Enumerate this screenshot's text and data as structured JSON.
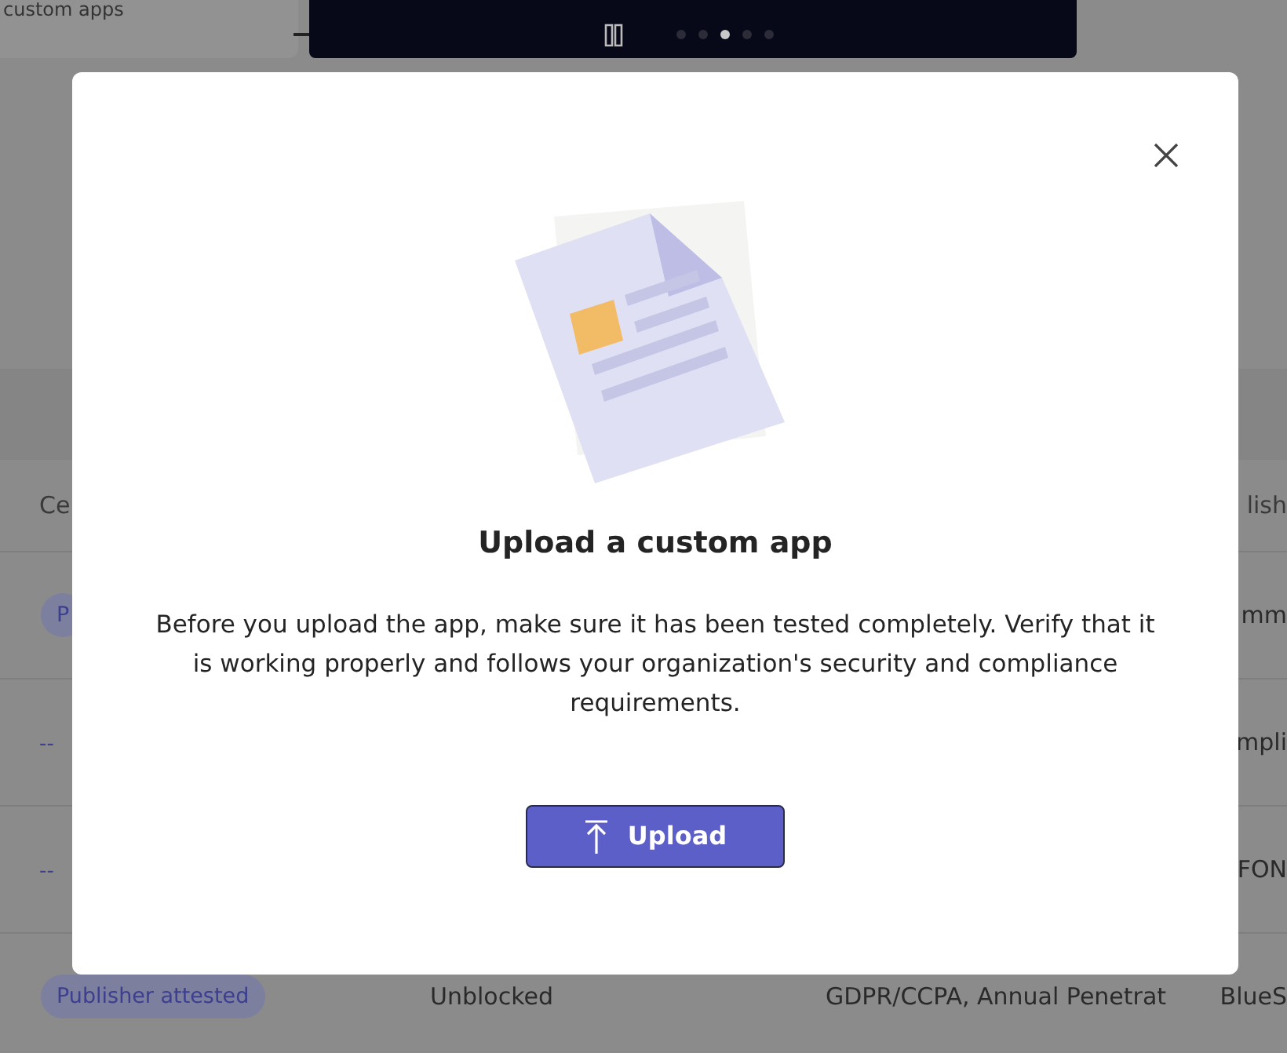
{
  "background": {
    "card_text": "custom apps",
    "carousel": {
      "dots": [
        {
          "selected": false
        },
        {
          "selected": false
        },
        {
          "selected": true
        },
        {
          "selected": false
        },
        {
          "selected": false
        }
      ]
    },
    "table": {
      "header": {
        "column_1": "Ce",
        "column_4": "lish"
      },
      "rows": [
        {
          "column_1": {
            "text": "P",
            "kind": "badge"
          },
          "column_4": {
            "text": "mm",
            "kind": "text"
          }
        },
        {
          "column_1": {
            "text": "--",
            "kind": "dash"
          },
          "column_4": {
            "text": "mpli",
            "kind": "text"
          }
        },
        {
          "column_1": {
            "text": "--",
            "kind": "dash"
          },
          "column_4": {
            "text": "FON",
            "kind": "text"
          }
        },
        {
          "column_1": {
            "text": "Publisher attested",
            "kind": "badge"
          },
          "column_2": {
            "text": "Unblocked",
            "kind": "text"
          },
          "column_3": {
            "text": "GDPR/CCPA, Annual Penetrat",
            "kind": "text"
          },
          "column_4": {
            "text": "BlueS",
            "kind": "text"
          }
        }
      ]
    }
  },
  "dialog": {
    "title": "Upload a custom app",
    "body": "Before you upload the app, make sure it has been tested completely. Verify that it is working properly and follows your organization's security and compliance requirements.",
    "button": "Upload"
  }
}
